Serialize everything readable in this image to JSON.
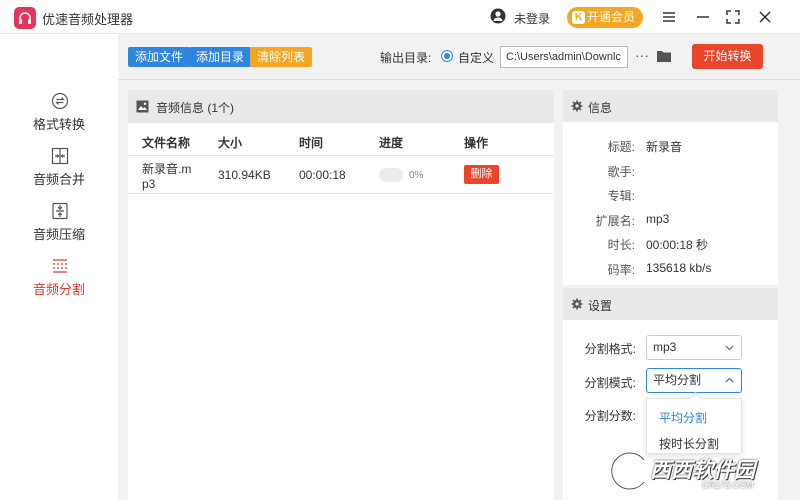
{
  "app": {
    "title": "优速音频处理器",
    "login_text": "未登录",
    "vip_label": "开通会员",
    "vip_icon_glyph": "K",
    "accent_color": "#e8335d"
  },
  "sidebar": {
    "items": [
      {
        "label": "格式转换",
        "icon": "swap-circle-icon",
        "active": false
      },
      {
        "label": "音频合并",
        "icon": "merge-icon",
        "active": false
      },
      {
        "label": "音频压缩",
        "icon": "compress-icon",
        "active": false
      },
      {
        "label": "音频分割",
        "icon": "split-icon",
        "active": true
      }
    ],
    "active_color": "#d63c2a"
  },
  "toolbar": {
    "add_file": "添加文件",
    "add_dir": "添加目录",
    "clear_list": "清除列表",
    "output_label": "输出目录:",
    "radio_label": "自定义",
    "output_path": "C:\\Users\\admin\\Downlc",
    "dots": "···",
    "start": "开始转换"
  },
  "audio_panel": {
    "title": "音频信息 (1个)",
    "columns": [
      "文件名称",
      "大小",
      "时间",
      "进度",
      "操作"
    ],
    "rows": [
      {
        "name_line1": "新录音.m",
        "name_line2": "p3",
        "size": "310.94KB",
        "time": "00:00:18",
        "progress_pct": "0%",
        "progress": 0,
        "action": "删除"
      }
    ]
  },
  "info_panel": {
    "title": "信息",
    "fields": [
      {
        "key": "标题:",
        "value": "新录音"
      },
      {
        "key": "歌手:",
        "value": ""
      },
      {
        "key": "专辑:",
        "value": ""
      },
      {
        "key": "扩展名:",
        "value": "mp3"
      },
      {
        "key": "时长:",
        "value": "00:00:18 秒"
      },
      {
        "key": "码率:",
        "value": "135618 kb/s"
      }
    ]
  },
  "settings_panel": {
    "title": "设置",
    "format_label": "分割格式:",
    "format_value": "mp3",
    "mode_label": "分割模式:",
    "mode_value": "平均分割",
    "count_label": "分割分数:",
    "mode_options": [
      "平均分割",
      "按时长分割"
    ]
  },
  "watermark": {
    "text": "西西软件园",
    "sub": "CR173.COM"
  }
}
